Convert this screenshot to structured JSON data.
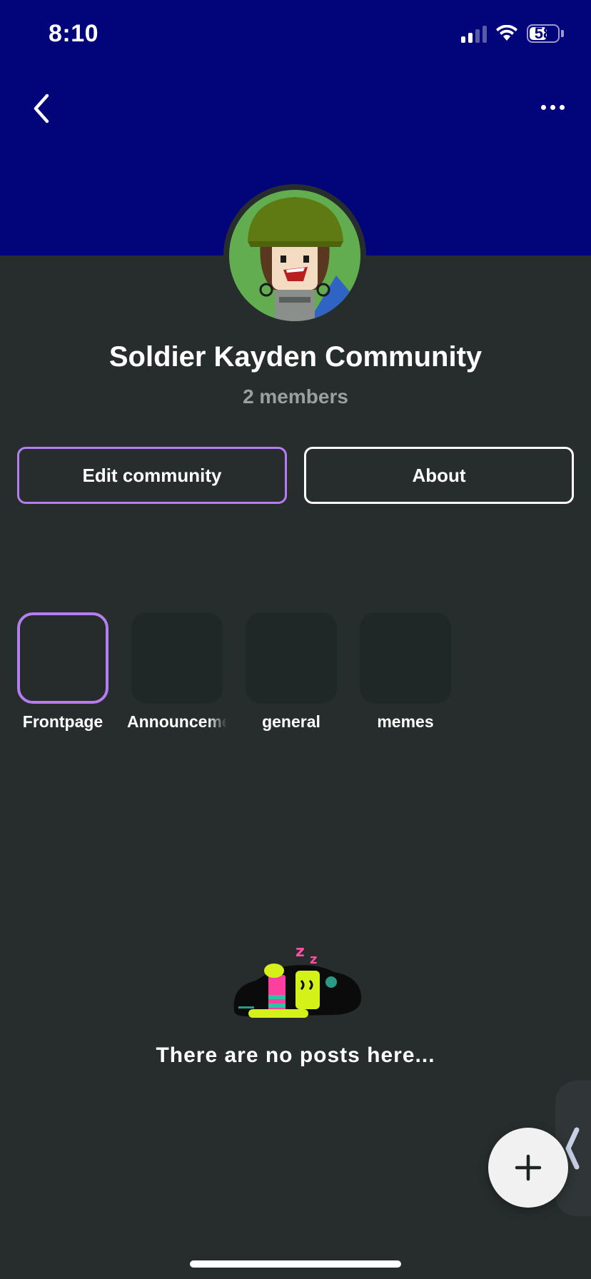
{
  "status_bar": {
    "time": "8:10",
    "battery": "58"
  },
  "header": {
    "banner_color": "#02047a",
    "back_icon": "chevron-left-icon",
    "more_icon": "more-horizontal-icon"
  },
  "community": {
    "name": "Soldier Kayden Community",
    "members": "2 members"
  },
  "actions": {
    "edit_label": "Edit community",
    "about_label": "About",
    "accent_color": "#b57ef0"
  },
  "channels": [
    {
      "label": "Frontpage",
      "active": true
    },
    {
      "label": "Announcements",
      "active": false
    },
    {
      "label": "general",
      "active": false
    },
    {
      "label": "memes",
      "active": false
    }
  ],
  "empty_state": {
    "message": "There are no posts here..."
  },
  "fab": {
    "icon": "plus-icon"
  }
}
